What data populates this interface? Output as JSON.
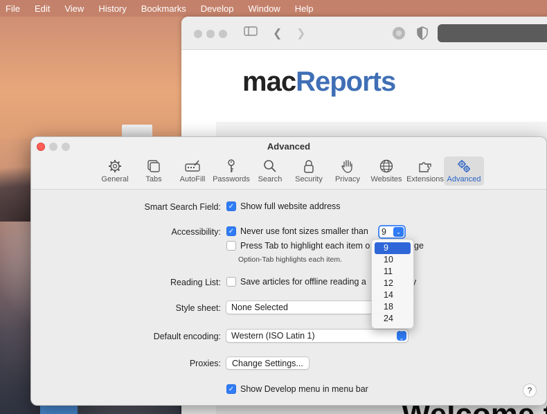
{
  "menubar": {
    "apple": "",
    "items": [
      "File",
      "Edit",
      "View",
      "History",
      "Bookmarks",
      "Develop",
      "Window",
      "Help"
    ]
  },
  "browser": {
    "logo_part1": "mac",
    "logo_part2": "Reports",
    "welcome_fragment": "Welcome t"
  },
  "prefs": {
    "title": "Advanced",
    "tabs": [
      {
        "label": "General",
        "icon": "gear-icon"
      },
      {
        "label": "Tabs",
        "icon": "tabs-icon"
      },
      {
        "label": "AutoFill",
        "icon": "autofill-icon"
      },
      {
        "label": "Passwords",
        "icon": "key-icon"
      },
      {
        "label": "Search",
        "icon": "search-icon"
      },
      {
        "label": "Security",
        "icon": "lock-icon"
      },
      {
        "label": "Privacy",
        "icon": "hand-icon"
      },
      {
        "label": "Websites",
        "icon": "globe-icon"
      },
      {
        "label": "Extensions",
        "icon": "puzzle-icon"
      },
      {
        "label": "Advanced",
        "icon": "gears-icon",
        "selected": true
      }
    ],
    "smart_search": {
      "label": "Smart Search Field:",
      "option": "Show full website address",
      "checked": true
    },
    "accessibility": {
      "label": "Accessibility:",
      "option1": "Never use font sizes smaller than",
      "option1_checked": true,
      "font_size_value": "9",
      "option2_prefix": "Press Tab to highlight each item o",
      "option2_suffix": "ge",
      "option2_checked": false,
      "note": "Option-Tab highlights each item."
    },
    "reading_list": {
      "label": "Reading List:",
      "option_prefix": "Save articles for offline reading a",
      "option_suffix": "y",
      "checked": false
    },
    "style_sheet": {
      "label": "Style sheet:",
      "value": "None Selected"
    },
    "encoding": {
      "label": "Default encoding:",
      "value": "Western (ISO Latin 1)"
    },
    "proxies": {
      "label": "Proxies:",
      "button": "Change Settings..."
    },
    "develop": {
      "option": "Show Develop menu in menu bar",
      "checked": true
    },
    "help": "?",
    "font_size_options": [
      "9",
      "10",
      "11",
      "12",
      "14",
      "18",
      "24"
    ],
    "selected_font_size": "9",
    "accent_color": "#2f7cf6"
  }
}
